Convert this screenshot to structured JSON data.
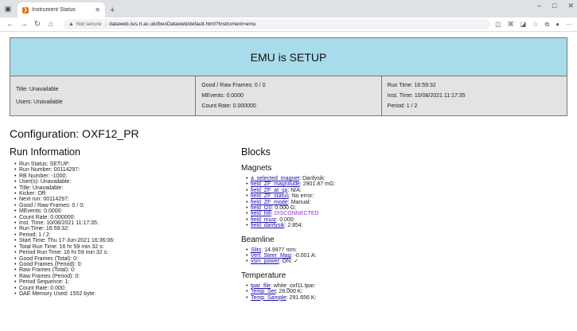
{
  "browser": {
    "tab_title": "Instrument Status",
    "url_warning": "Not secure",
    "url": "dataweb.isis.rl.ac.uk/IbexDataweb/default.html?Instrument=emu"
  },
  "banner": {
    "title": "EMU is SETUP",
    "color": "#a9dcea"
  },
  "status_panel": {
    "col1": [
      "Title: Unavailable",
      "Users: Unavailable"
    ],
    "col2": [
      "Good / Raw Frames: 0 / 0",
      "MEvents: 0.0000",
      "Count Rate: 0.000000"
    ],
    "col3": [
      "Run Time: 16:59:32",
      "Inst. Time: 10/08/2021 11:17:35",
      "Period: 1 / 2"
    ]
  },
  "configuration": "Configuration: OXF12_PR",
  "run_information": {
    "heading": "Run Information",
    "items": [
      "Run Status:  SETUP:",
      "Run Number:  00114297:",
      "RB Number:  -1000:",
      "User(s):  Unavailable:",
      "Title:  Unavailable:",
      "Kicker:  Off:",
      "Next run:  00114297:",
      "Good / Raw Frames:  0 / 0:",
      "MEvents:  0.0000:",
      "Count Rate:  0.000000:",
      "Inst. Time:  10/08/2021 11:17:35:",
      "Run Time:  16:59:32:",
      "Period:  1 / 2:",
      "Start Time:  Thu 17-Jun-2021 16:36:06:",
      "Total Run Time:  16 hr 59 min 32 s:",
      "Period Run Time:  16 hr 59 min 32 s:",
      "Good Frames (Total):  0:",
      "Good Frames (Period):  0:",
      "Raw Frames (Total):  0:",
      "Raw Frames (Period):  0:",
      "Period Sequence:  1:",
      "Count Rate:  0.000:",
      "DAE Memory Used:  1552 byte:"
    ]
  },
  "blocks": {
    "heading": "Blocks",
    "magnets": {
      "heading": "Magnets",
      "items": [
        {
          "name": "a_selected_magnet",
          "value": "Danfysik:"
        },
        {
          "name": "field_ZF_magnitude",
          "value": "2901.87 mG:"
        },
        {
          "name": "field_ZF_at_sp",
          "value": "N/A:"
        },
        {
          "name": "field_ZF_status",
          "value": "No error:"
        },
        {
          "name": "field_ZF_mode",
          "value": "Manual:"
        },
        {
          "name": "field_t20",
          "value": "0.000 G:"
        },
        {
          "name": "field_hifi",
          "value": "DISCONNECTED"
        },
        {
          "name": "field_musr",
          "value": "0.000:"
        },
        {
          "name": "field_danfysik",
          "value": "2.854:"
        }
      ]
    },
    "beamline": {
      "heading": "Beamline",
      "items": [
        {
          "name": "Slits",
          "value": "14.9977 mm:"
        },
        {
          "name": "Vert_Steer_Mag",
          "value": "-0.001 A:"
        },
        {
          "name": "vsm_power",
          "value": "ON: ✓"
        }
      ]
    },
    "temperature": {
      "heading": "Temperature",
      "items": [
        {
          "name": "tpar_file",
          "value": "white_oxf11.tpar:"
        },
        {
          "name": "Temp_Set",
          "value": "28.000 K:"
        },
        {
          "name": "Temp_Sample",
          "value": "291.656 K:"
        }
      ]
    }
  }
}
